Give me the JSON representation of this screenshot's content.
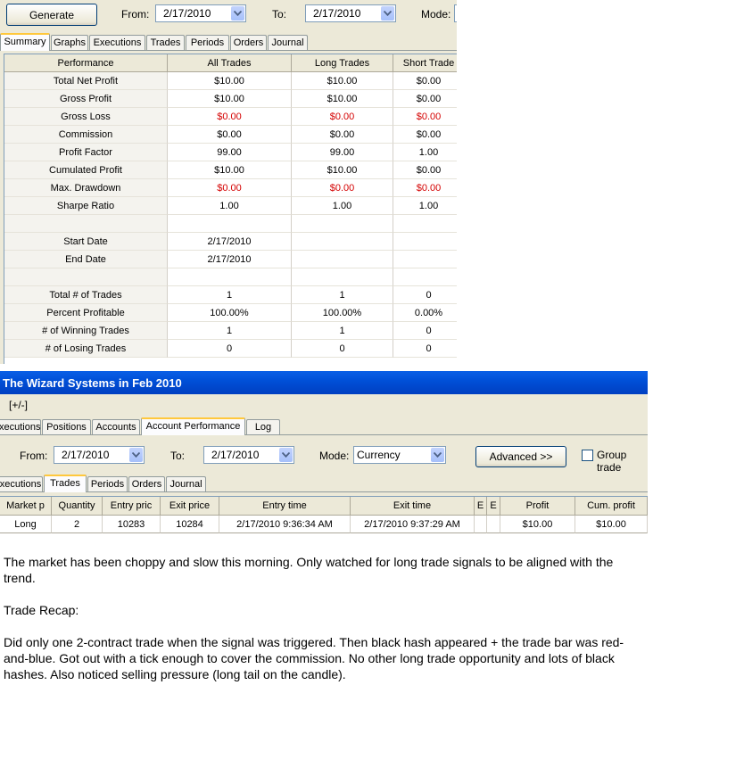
{
  "top_toolbar": {
    "generate_label": "Generate",
    "from_label": "From:",
    "from_value": "2/17/2010",
    "to_label": "To:",
    "to_value": "2/17/2010",
    "mode_label": "Mode:"
  },
  "top_tabs": [
    "Summary",
    "Graphs",
    "Executions",
    "Trades",
    "Periods",
    "Orders",
    "Journal"
  ],
  "summary": {
    "headers": [
      "Performance",
      "All Trades",
      "Long Trades",
      "Short Trade"
    ],
    "rows": [
      [
        "Total Net Profit",
        "$10.00",
        "$10.00",
        "$0.00"
      ],
      [
        "Gross Profit",
        "$10.00",
        "$10.00",
        "$0.00"
      ],
      [
        "Gross Loss",
        "$0.00",
        "$0.00",
        "$0.00"
      ],
      [
        "Commission",
        "$0.00",
        "$0.00",
        "$0.00"
      ],
      [
        "Profit Factor",
        "99.00",
        "99.00",
        "1.00"
      ],
      [
        "Cumulated Profit",
        "$10.00",
        "$10.00",
        "$0.00"
      ],
      [
        "Max. Drawdown",
        "$0.00",
        "$0.00",
        "$0.00"
      ],
      [
        "Sharpe Ratio",
        "1.00",
        "1.00",
        "1.00"
      ],
      [
        "",
        "",
        "",
        ""
      ],
      [
        "Start Date",
        "2/17/2010",
        "",
        ""
      ],
      [
        "End Date",
        "2/17/2010",
        "",
        ""
      ],
      [
        "",
        "",
        "",
        ""
      ],
      [
        "Total # of Trades",
        "1",
        "1",
        "0"
      ],
      [
        "Percent Profitable",
        "100.00%",
        "100.00%",
        "0.00%"
      ],
      [
        "# of Winning Trades",
        "1",
        "1",
        "0"
      ],
      [
        "# of Losing Trades",
        "0",
        "0",
        "0"
      ]
    ],
    "red_row_indices": [
      2,
      6
    ],
    "loss_color": "#d40000"
  },
  "wizard": {
    "title": "The Wizard Systems in Feb 2010",
    "expand_label": "[+/-]",
    "tabs": [
      "xecutions",
      "Positions",
      "Accounts",
      "Account Performance",
      "Log"
    ],
    "from_label": "From:",
    "from_value": "2/17/2010",
    "to_label": "To:",
    "to_value": "2/17/2010",
    "mode_label": "Mode:",
    "mode_value": "Currency",
    "advanced_label": "Advanced >>",
    "group_label": "Group trade",
    "sub_tabs": [
      "xecutions",
      "Trades",
      "Periods",
      "Orders",
      "Journal"
    ],
    "trade_headers": [
      "Market p",
      "Quantity",
      "Entry pric",
      "Exit price",
      "Entry time",
      "Exit time",
      "E",
      "E",
      "Profit",
      "Cum. profit"
    ],
    "trade_rows": [
      [
        "Long",
        "2",
        "10283",
        "10284",
        "2/17/2010 9:36:34 AM",
        "2/17/2010 9:37:29 AM",
        "",
        "",
        "$10.00",
        "$10.00"
      ]
    ]
  },
  "notes": {
    "p1": "The market has been choppy and slow this morning.  Only watched for long trade signals to be aligned with the trend.",
    "p2": "Trade Recap:",
    "p3": "Did only one 2-contract trade when the signal was triggered.  Then black hash appeared + the trade bar was red-and-blue.  Got out with a tick enough to cover the commission.  No other long trade opportunity and lots of black hashes.  Also noticed selling pressure (long tail on the candle)."
  },
  "colors": {
    "title_bar": "#0050d8",
    "active_tab_accent": "#ffc83c"
  }
}
